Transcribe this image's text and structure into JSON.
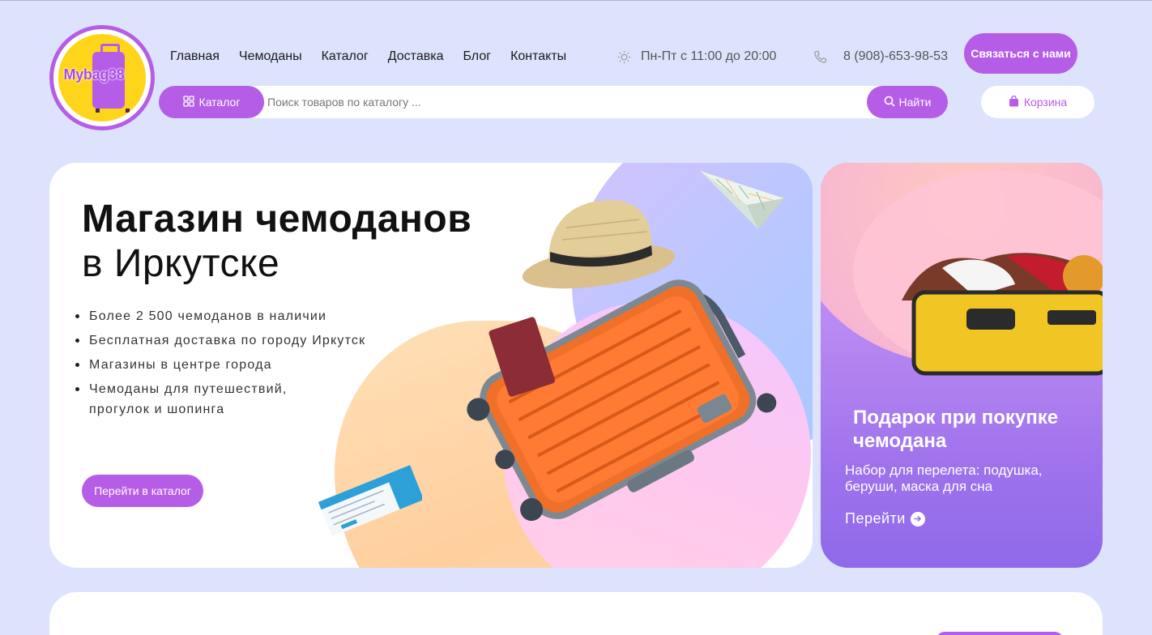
{
  "logo": {
    "text": "Mybag38"
  },
  "nav": {
    "items": [
      {
        "label": "Главная"
      },
      {
        "label": "Чемоданы"
      },
      {
        "label": "Каталог"
      },
      {
        "label": "Доставка"
      },
      {
        "label": "Блог"
      },
      {
        "label": "Контакты"
      }
    ]
  },
  "header": {
    "hours": "Пн-Пт с 11:00 до 20:00",
    "phone": "8 (908)-653-98-53",
    "contact_button": "Связаться с нами",
    "hours_icon": "sun-icon",
    "phone_icon": "phone-icon"
  },
  "search": {
    "catalog_button": "Каталог",
    "placeholder": "Поиск товаров по каталогу ...",
    "value": "",
    "find_button": "Найти",
    "cart_button": "Корзина"
  },
  "hero": {
    "title_line1": "Магазин чемоданов",
    "title_line2": "в Иркутске",
    "bullets": [
      "Более 2 500 чемоданов в наличии",
      "Бесплатная доставка по городу Иркутск",
      "Магазины в центре города",
      "Чемоданы для путешествий,",
      "прогулок и шопинга"
    ],
    "cta": "Перейти в каталог"
  },
  "promo": {
    "title": "Подарок при покупке чемодана",
    "text": "Набор для перелета: подушка, беруши, маска для сна",
    "link": "Перейти"
  },
  "colors": {
    "accent": "#b65de8",
    "page_bg": "#dde3fd",
    "card_bg": "#ffffff",
    "promo_gradient_top": "#c98bf3",
    "promo_gradient_bottom": "#8f69ea"
  }
}
